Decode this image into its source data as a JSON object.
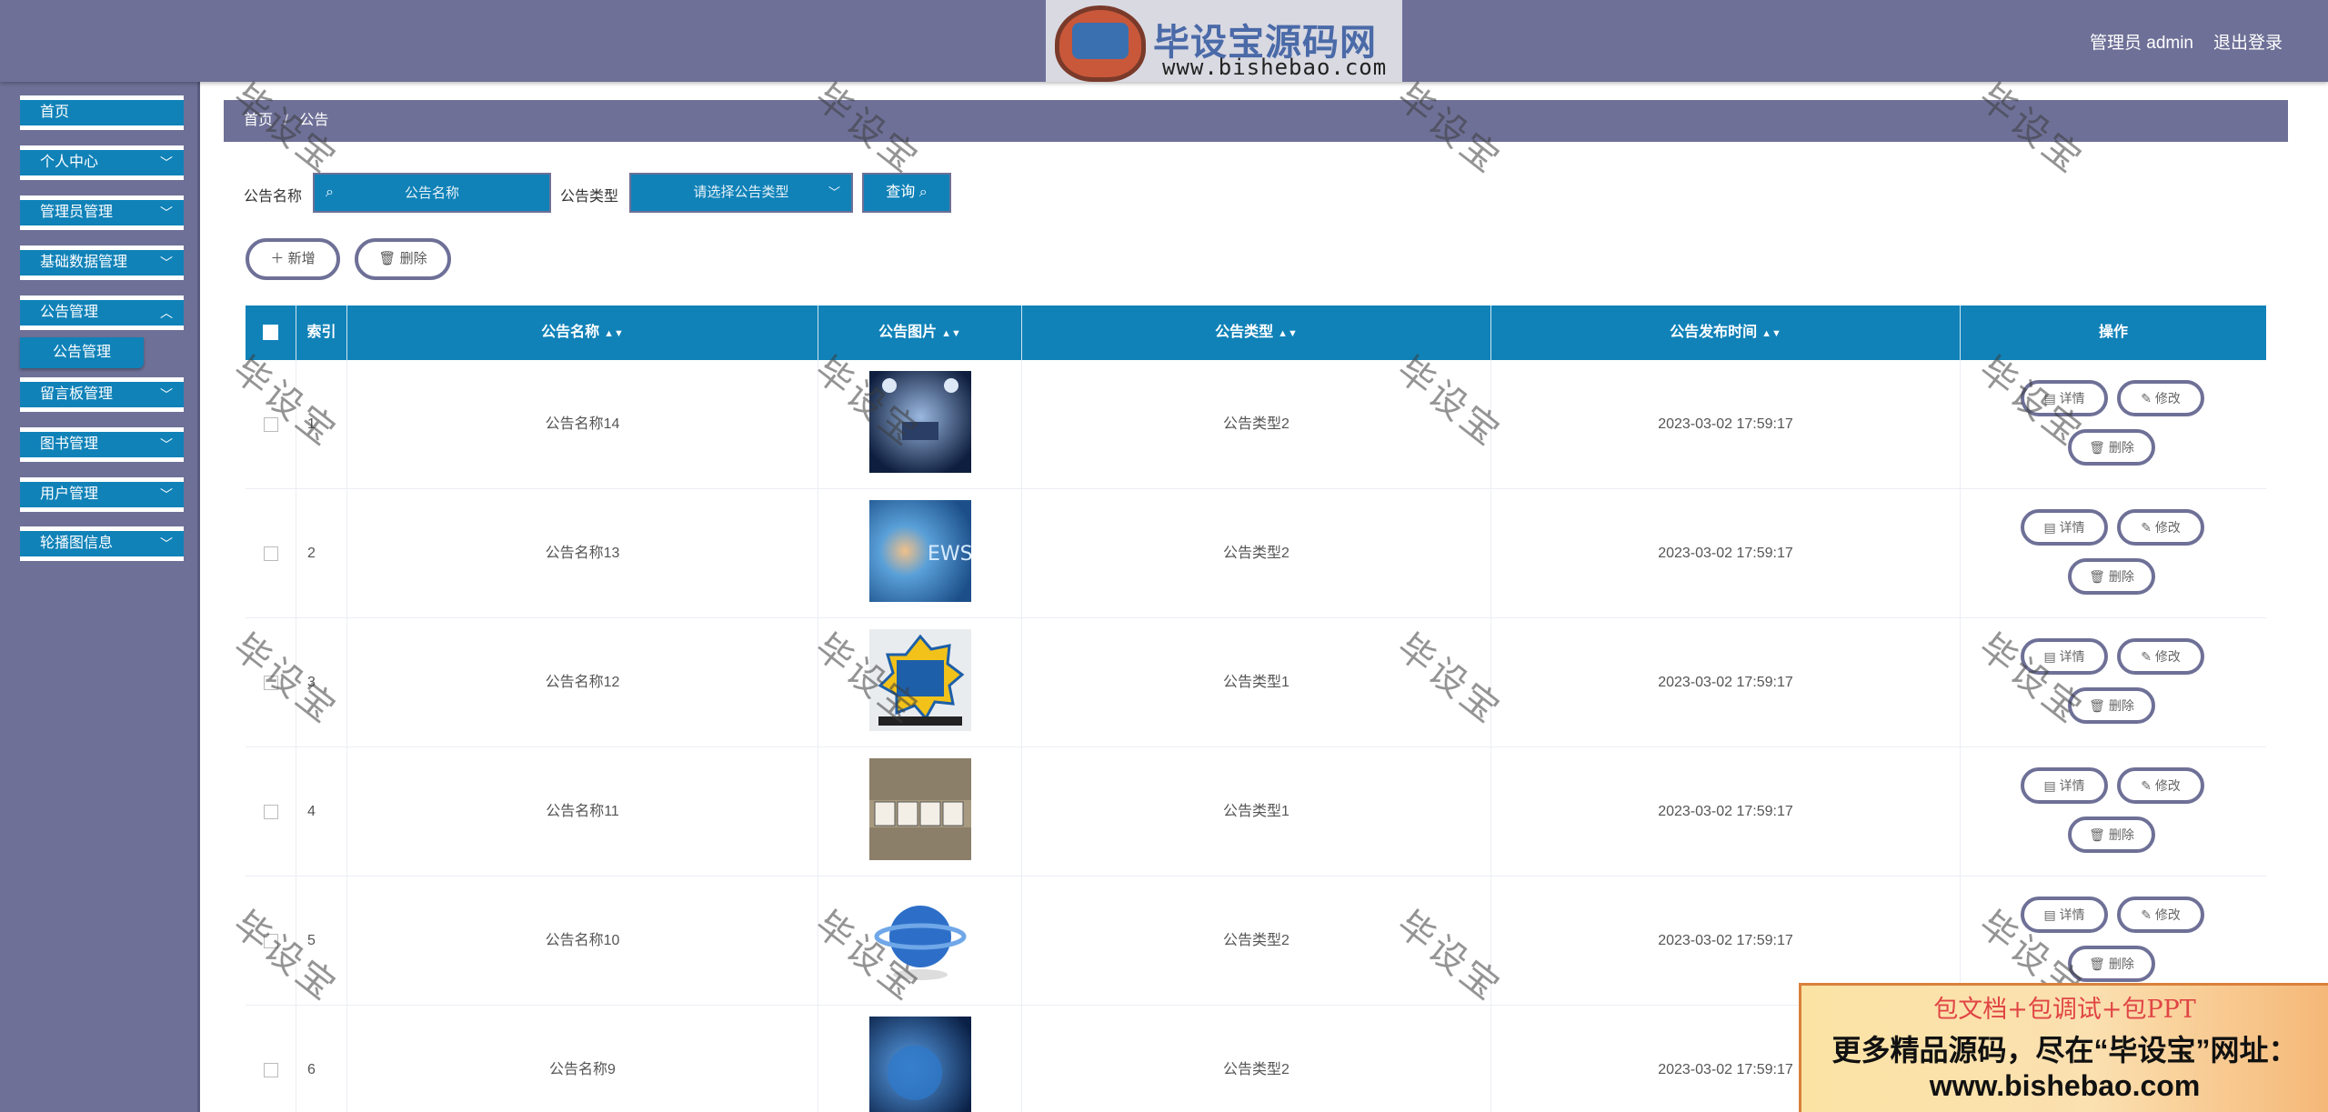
{
  "header": {
    "logo_title": "毕设宝源码网",
    "logo_url": "www.bishebao.com",
    "user_label": "管理员 admin",
    "logout_label": "退出登录"
  },
  "sidebar": {
    "items": [
      {
        "label": "首页"
      },
      {
        "label": "个人中心"
      },
      {
        "label": "管理员管理"
      },
      {
        "label": "基础数据管理"
      },
      {
        "label": "公告管理"
      },
      {
        "label": "留言板管理"
      },
      {
        "label": "图书管理"
      },
      {
        "label": "用户管理"
      },
      {
        "label": "轮播图信息"
      }
    ],
    "sub_item": "公告管理"
  },
  "breadcrumb": {
    "home": "首页",
    "separator": "/",
    "current": "公告"
  },
  "search": {
    "name_label": "公告名称",
    "name_placeholder": "公告名称",
    "type_label": "公告类型",
    "type_placeholder": "请选择公告类型",
    "query_label": "查询"
  },
  "actions": {
    "add_label": "新增",
    "delete_label": "删除"
  },
  "table": {
    "columns": {
      "index": "索引",
      "name": "公告名称",
      "image": "公告图片",
      "type": "公告类型",
      "time": "公告发布时间",
      "ops": "操作"
    },
    "row_actions": {
      "detail": "详情",
      "edit": "修改",
      "delete": "删除"
    },
    "rows": [
      {
        "index": "1",
        "name": "公告名称14",
        "type": "公告类型2",
        "time": "2023-03-02 17:59:17"
      },
      {
        "index": "2",
        "name": "公告名称13",
        "type": "公告类型2",
        "time": "2023-03-02 17:59:17"
      },
      {
        "index": "3",
        "name": "公告名称12",
        "type": "公告类型1",
        "time": "2023-03-02 17:59:17"
      },
      {
        "index": "4",
        "name": "公告名称11",
        "type": "公告类型1",
        "time": "2023-03-02 17:59:17"
      },
      {
        "index": "5",
        "name": "公告名称10",
        "type": "公告类型2",
        "time": "2023-03-02 17:59:17"
      },
      {
        "index": "6",
        "name": "公告名称9",
        "type": "公告类型2",
        "time": "2023-03-02 17:59:17"
      }
    ]
  },
  "watermark": "毕设宝",
  "promo": {
    "line1": "包文档+包调试+包PPT",
    "line2": "更多精品源码，尽在“毕设宝”网址：",
    "line3": "www.bishebao.com"
  },
  "colors": {
    "primary": "#1082b8",
    "header": "#6e7097",
    "accent_red": "#e04545"
  },
  "icons": {
    "search": "search-icon",
    "chevron": "chevron-down-icon",
    "plus": "plus-icon",
    "trash": "trash-icon",
    "doc": "document-icon",
    "pencil": "pencil-icon",
    "sort": "sort-icon"
  }
}
